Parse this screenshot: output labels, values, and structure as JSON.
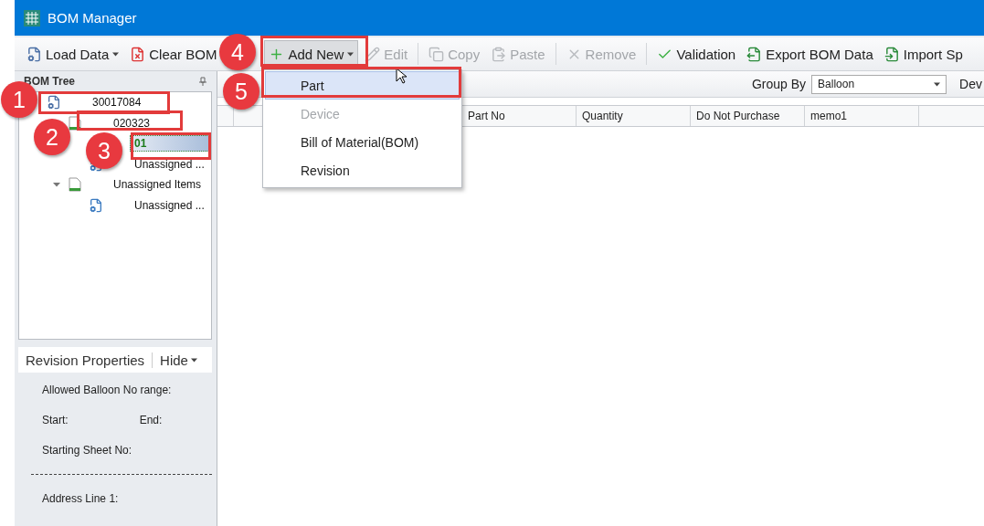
{
  "window": {
    "title": "BOM Manager"
  },
  "toolbar": [
    {
      "kind": "button",
      "label": "Load Data",
      "dropdown": true,
      "disabled": false,
      "pressed": false
    },
    {
      "kind": "button",
      "label": "Clear BOM",
      "dropdown": false,
      "disabled": false,
      "pressed": false
    },
    {
      "kind": "separator"
    },
    {
      "kind": "button",
      "label": "Add New",
      "dropdown": true,
      "disabled": false,
      "pressed": true
    },
    {
      "kind": "button",
      "label": "Edit",
      "dropdown": false,
      "disabled": true,
      "pressed": false
    },
    {
      "kind": "separator"
    },
    {
      "kind": "button",
      "label": "Copy",
      "dropdown": false,
      "disabled": true,
      "pressed": false
    },
    {
      "kind": "button",
      "label": "Paste",
      "dropdown": false,
      "disabled": true,
      "pressed": false
    },
    {
      "kind": "separator"
    },
    {
      "kind": "button",
      "label": "Remove",
      "dropdown": false,
      "disabled": true,
      "pressed": false
    },
    {
      "kind": "separator"
    },
    {
      "kind": "button",
      "label": "Validation",
      "dropdown": false,
      "disabled": false,
      "pressed": false
    },
    {
      "kind": "button",
      "label": "Export BOM Data",
      "dropdown": false,
      "disabled": false,
      "pressed": false
    },
    {
      "kind": "button",
      "label": "Import Sp",
      "dropdown": false,
      "disabled": false,
      "pressed": false
    }
  ],
  "bom_tree": {
    "title": "BOM Tree",
    "nodes": [
      {
        "label": "30017084",
        "kind": "bom",
        "selected": false,
        "children": [
          {
            "label": "020323",
            "kind": "part",
            "selected": false,
            "children": [
              {
                "label": "01",
                "kind": "revision",
                "selected": true
              },
              {
                "label": "Unassigned ...",
                "kind": "group",
                "selected": false
              }
            ]
          },
          {
            "label": "Unassigned Items",
            "kind": "part",
            "expanded": true,
            "selected": false,
            "children": [
              {
                "label": "Unassigned ...",
                "kind": "group",
                "selected": false
              }
            ]
          }
        ]
      }
    ]
  },
  "properties_panel": {
    "tabs": [
      {
        "label": "Revision Properties",
        "kind": "tab"
      },
      {
        "label": "Hide",
        "kind": "menu"
      }
    ],
    "rows": [
      {
        "kind": "label",
        "texts": [
          "Allowed Balloon No range:"
        ]
      },
      {
        "kind": "pair",
        "texts": [
          "Start:",
          "End:"
        ]
      },
      {
        "kind": "label",
        "texts": [
          "Starting Sheet No:"
        ]
      },
      {
        "kind": "divider"
      },
      {
        "kind": "label",
        "texts": [
          "Address Line 1:"
        ]
      }
    ]
  },
  "grid_toolbar": {
    "group_by_label": "Group By",
    "group_by_value": "Balloon",
    "column_cut": "Dev"
  },
  "table": {
    "columns": [
      "Part No",
      "Quantity",
      "Do Not Purchase",
      "memo1"
    ]
  },
  "add_new_menu": [
    {
      "label": "Part",
      "disabled": false,
      "selected": true
    },
    {
      "label": "Device",
      "disabled": true,
      "selected": false
    },
    {
      "label": "Bill of Material(BOM)",
      "disabled": false,
      "selected": false
    },
    {
      "label": "Revision",
      "disabled": false,
      "selected": false
    }
  ],
  "callouts": [
    "1",
    "2",
    "3",
    "4",
    "5"
  ]
}
